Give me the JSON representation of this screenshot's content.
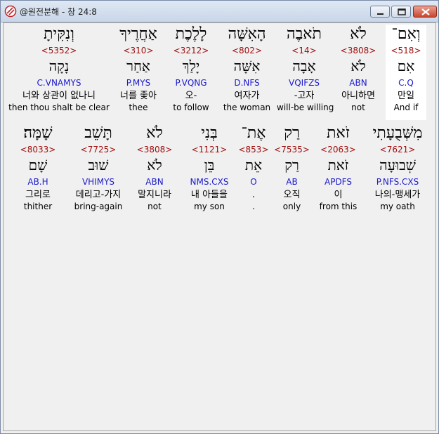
{
  "window": {
    "title": "@원전분해 - 창 24:8",
    "colors": {
      "strong": "#a01010",
      "morph": "#1a1acc",
      "highlight": "#ffffff"
    }
  },
  "rows": [
    {
      "words": [
        {
          "heb": "וְאִם־",
          "strong": "<518>",
          "lex": "אִם",
          "morph": "C.Q",
          "kor": "만일",
          "eng": "And if",
          "selected": true
        },
        {
          "heb": "לֹא",
          "strong": "<3808>",
          "lex": "לֹא",
          "morph": "ABN",
          "kor": "아니하면",
          "eng": "not"
        },
        {
          "heb": "תֹאבֶה",
          "strong": "<14>",
          "lex": "אָבָה",
          "morph": "VQIFZS",
          "kor": "-고자",
          "eng": "will-be willing"
        },
        {
          "heb": "הָאִשָּׁה",
          "strong": "<802>",
          "lex": "אִשָּׁה",
          "morph": "D.NFS",
          "kor": "여자가",
          "eng": "the woman"
        },
        {
          "heb": "לָלֶכֶת",
          "strong": "<3212>",
          "lex": "יָלַךְ",
          "morph": "P.VQNG",
          "kor": "오-",
          "eng": "to follow"
        },
        {
          "heb": "אַחֲרֶיךָ",
          "strong": "<310>",
          "lex": "אַחַר",
          "morph": "P.MYS",
          "kor": "너를 좇아",
          "eng": "thee"
        },
        {
          "heb": "וְנִקִּיתָ",
          "strong": "<5352>",
          "lex": "נָקָה",
          "morph": "C.VNAMYS",
          "kor": "너와 상관이 없나니",
          "eng": "then thou shalt be clear"
        }
      ]
    },
    {
      "words": [
        {
          "heb": "מִשְּׁבֻעָתִי",
          "strong": "<7621>",
          "lex": "שְׁבוּעָה",
          "morph": "P.NFS.CXS",
          "kor": "나의-맹세가",
          "eng": "my oath"
        },
        {
          "heb": "זֹאת",
          "strong": "<2063>",
          "lex": "זֹאת",
          "morph": "APDFS",
          "kor": "이",
          "eng": "from this"
        },
        {
          "heb": "רַק",
          "strong": "<7535>",
          "lex": "רַק",
          "morph": "AB",
          "kor": "오직",
          "eng": "only"
        },
        {
          "heb": "אֶת־",
          "strong": "<853>",
          "lex": "אֵת",
          "morph": "O",
          "kor": ".",
          "eng": "."
        },
        {
          "heb": "בְּנִי",
          "strong": "<1121>",
          "lex": "בֵּן",
          "morph": "NMS.CXS",
          "kor": "내 아들을",
          "eng": "my son"
        },
        {
          "heb": "לֹא",
          "strong": "<3808>",
          "lex": "לֹא",
          "morph": "ABN",
          "kor": "말지니라",
          "eng": "not"
        },
        {
          "heb": "תָּשֵׁב",
          "strong": "<7725>",
          "lex": "שׁוּב",
          "morph": "VHIMYS",
          "kor": "데리고-가지",
          "eng": "bring-again"
        },
        {
          "heb": "שָׁמָּה׃",
          "strong": "<8033>",
          "lex": "שָׁם",
          "morph": "AB.H",
          "kor": "그리로",
          "eng": "thither"
        }
      ]
    }
  ]
}
